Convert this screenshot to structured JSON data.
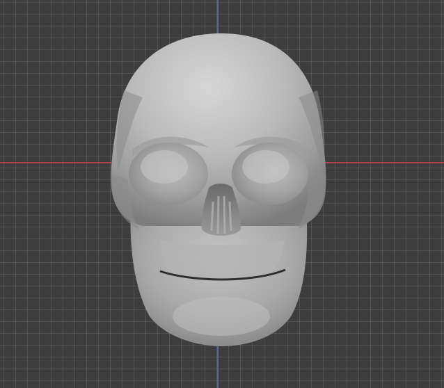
{
  "viewport": {
    "grid_visible": true,
    "background_color": "#3d3d3d",
    "x_axis_color": "#a8424b",
    "y_axis_color": "#4f6ea3"
  },
  "model": {
    "shading": "solid",
    "material_color": "#b9b9b9"
  }
}
